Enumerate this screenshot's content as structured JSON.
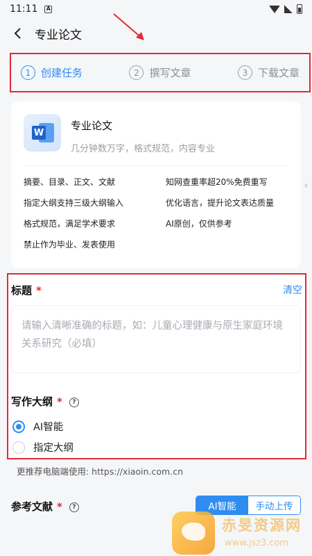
{
  "status_bar": {
    "time": "11:11",
    "notif": "A"
  },
  "header": {
    "title": "专业论文"
  },
  "steps": [
    {
      "num": "1",
      "label": "创建任务",
      "active": true
    },
    {
      "num": "2",
      "label": "撰写文章",
      "active": false
    },
    {
      "num": "3",
      "label": "下载文章",
      "active": false
    }
  ],
  "card": {
    "title": "专业论文",
    "subtitle": "几分钟数万字，格式规范，内容专业",
    "features": [
      "摘要、目录、正文、文献",
      "知网查重率超20%免费重写",
      "指定大纲支持三级大纲输入",
      "优化语言，提升论文表达质量",
      "格式规范，满足学术要求",
      "AI原创，仅供参考",
      "禁止作为毕业、发表使用"
    ]
  },
  "form": {
    "title_label": "标题",
    "required_mark": "*",
    "clear_label": "清空",
    "title_placeholder": "请输入清晰准确的标题，如：儿童心理健康与原生家庭环境关系研究（必填）",
    "outline_label": "写作大纲",
    "outline_options": [
      {
        "label": "AI智能",
        "checked": true
      },
      {
        "label": "指定大纲",
        "checked": false
      }
    ]
  },
  "recommend_text": "更推荐电脑端使用: https://xiaoin.com.cn",
  "reference": {
    "label": "参考文献",
    "options": [
      {
        "label": "AI智能",
        "active": true
      },
      {
        "label": "手动上传",
        "active": false
      }
    ]
  },
  "watermark": {
    "name": "赤旻资源网",
    "url": "www.jsz3.com"
  },
  "colors": {
    "accent": "#2f8cf0",
    "annotation": "#e02a34"
  }
}
